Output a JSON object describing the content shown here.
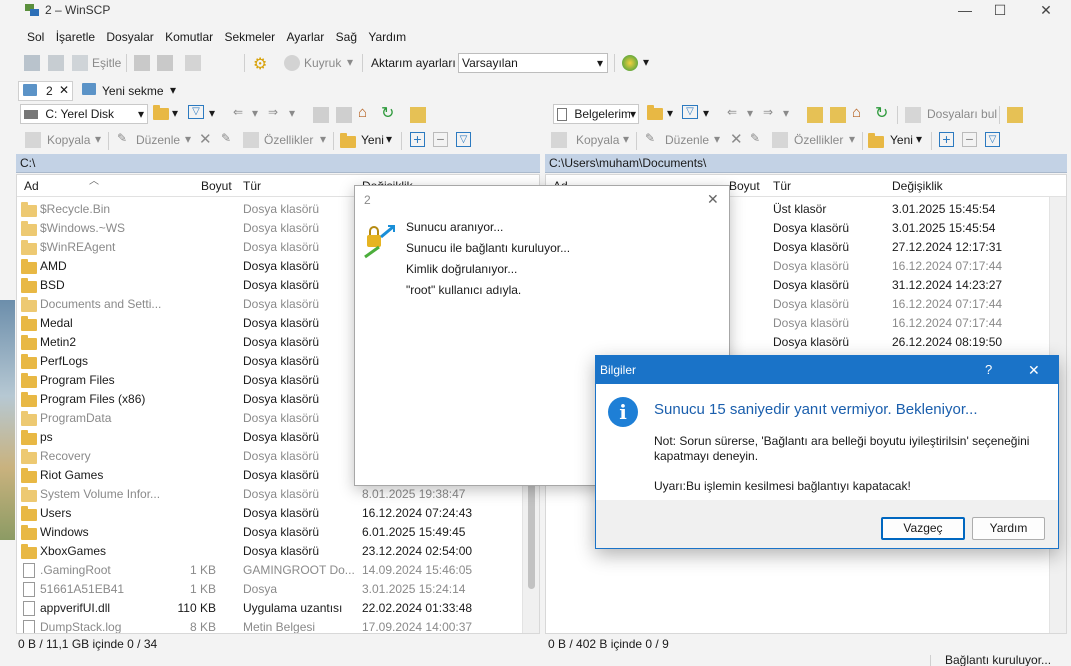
{
  "window": {
    "title": "2 – WinSCP",
    "minimize_glyph": "—",
    "maximize_glyph": "☐",
    "close_glyph": "✕"
  },
  "menu": [
    "Sol",
    "İşaretle",
    "Dosyalar",
    "Komutlar",
    "Sekmeler",
    "Ayarlar",
    "Sağ",
    "Yardım"
  ],
  "toolbar1": {
    "sync_label": "Eşitle",
    "queue_label": "Kuyruk",
    "transfer_settings_label": "Aktarım ayarları",
    "transfer_settings_value": "Varsayılan"
  },
  "tabs": {
    "session_tab": "2",
    "new_tab": "Yeni sekme"
  },
  "left": {
    "drive": "C: Yerel Disk",
    "copy": "Kopyala",
    "edit": "Düzenle",
    "properties": "Özellikler",
    "new": "Yeni",
    "path": "C:\\",
    "columns": {
      "name": "Ad",
      "size": "Boyut",
      "type": "Tür",
      "changed": "Değişiklik"
    },
    "rows": [
      {
        "name": "$Recycle.Bin",
        "size": "",
        "type": "Dosya klasörü",
        "changed": "",
        "hidden": true,
        "icon": "folder"
      },
      {
        "name": "$Windows.~WS",
        "size": "",
        "type": "Dosya klasörü",
        "changed": "",
        "hidden": true,
        "icon": "folder"
      },
      {
        "name": "$WinREAgent",
        "size": "",
        "type": "Dosya klasörü",
        "changed": "",
        "hidden": true,
        "icon": "folder"
      },
      {
        "name": "AMD",
        "size": "",
        "type": "Dosya klasörü",
        "changed": "",
        "hidden": false,
        "icon": "folder"
      },
      {
        "name": "BSD",
        "size": "",
        "type": "Dosya klasörü",
        "changed": "",
        "hidden": false,
        "icon": "folder"
      },
      {
        "name": "Documents and Setti...",
        "size": "",
        "type": "Dosya klasörü",
        "changed": "",
        "hidden": true,
        "icon": "folder"
      },
      {
        "name": "Medal",
        "size": "",
        "type": "Dosya klasörü",
        "changed": "",
        "hidden": false,
        "icon": "folder"
      },
      {
        "name": "Metin2",
        "size": "",
        "type": "Dosya klasörü",
        "changed": "",
        "hidden": false,
        "icon": "folder"
      },
      {
        "name": "PerfLogs",
        "size": "",
        "type": "Dosya klasörü",
        "changed": "",
        "hidden": false,
        "icon": "folder"
      },
      {
        "name": "Program Files",
        "size": "",
        "type": "Dosya klasörü",
        "changed": "",
        "hidden": false,
        "icon": "folder"
      },
      {
        "name": "Program Files (x86)",
        "size": "",
        "type": "Dosya klasörü",
        "changed": "",
        "hidden": false,
        "icon": "folder"
      },
      {
        "name": "ProgramData",
        "size": "",
        "type": "Dosya klasörü",
        "changed": "",
        "hidden": true,
        "icon": "folder"
      },
      {
        "name": "ps",
        "size": "",
        "type": "Dosya klasörü",
        "changed": "",
        "hidden": false,
        "icon": "folder"
      },
      {
        "name": "Recovery",
        "size": "",
        "type": "Dosya klasörü",
        "changed": "",
        "hidden": true,
        "icon": "folder"
      },
      {
        "name": "Riot Games",
        "size": "",
        "type": "Dosya klasörü",
        "changed": "",
        "hidden": false,
        "icon": "folder"
      },
      {
        "name": "System Volume Infor...",
        "size": "",
        "type": "Dosya klasörü",
        "changed": "8.01.2025 19:38:47",
        "hidden": true,
        "icon": "folder"
      },
      {
        "name": "Users",
        "size": "",
        "type": "Dosya klasörü",
        "changed": "16.12.2024 07:24:43",
        "hidden": false,
        "icon": "folder"
      },
      {
        "name": "Windows",
        "size": "",
        "type": "Dosya klasörü",
        "changed": "6.01.2025 15:49:45",
        "hidden": false,
        "icon": "folder"
      },
      {
        "name": "XboxGames",
        "size": "",
        "type": "Dosya klasörü",
        "changed": "23.12.2024 02:54:00",
        "hidden": false,
        "icon": "folder"
      },
      {
        "name": ".GamingRoot",
        "size": "1 KB",
        "type": "GAMINGROOT Do...",
        "changed": "14.09.2024 15:46:05",
        "hidden": true,
        "icon": "file"
      },
      {
        "name": "51661A51EB41",
        "size": "1 KB",
        "type": "Dosya",
        "changed": "3.01.2025 15:24:14",
        "hidden": true,
        "icon": "file"
      },
      {
        "name": "appverifUI.dll",
        "size": "110 KB",
        "type": "Uygulama uzantısı",
        "changed": "22.02.2024 01:33:48",
        "hidden": false,
        "icon": "file"
      },
      {
        "name": "DumpStack.log",
        "size": "8 KB",
        "type": "Metin Belgesi",
        "changed": "17.09.2024 14:00:37",
        "hidden": true,
        "icon": "file"
      }
    ],
    "status": "0 B / 11,1 GB içinde 0 / 34"
  },
  "right": {
    "folder": "Belgelerim",
    "find_files": "Dosyaları bul",
    "copy": "Kopyala",
    "edit": "Düzenle",
    "properties": "Özellikler",
    "new": "Yeni",
    "path": "C:\\Users\\muham\\Documents\\",
    "columns": {
      "name": "Ad",
      "size": "Boyut",
      "type": "Tür",
      "changed": "Değişiklik"
    },
    "rows": [
      {
        "type": "Üst klasör",
        "changed": "3.01.2025 15:45:54",
        "hidden": false
      },
      {
        "type": "Dosya klasörü",
        "changed": "3.01.2025 15:45:54",
        "hidden": false
      },
      {
        "type": "Dosya klasörü",
        "changed": "27.12.2024 12:17:31",
        "hidden": false
      },
      {
        "type": "Dosya klasörü",
        "changed": "16.12.2024 07:17:44",
        "hidden": true
      },
      {
        "type": "Dosya klasörü",
        "changed": "31.12.2024 14:23:27",
        "hidden": false
      },
      {
        "type": "Dosya klasörü",
        "changed": "16.12.2024 07:17:44",
        "hidden": true
      },
      {
        "type": "Dosya klasörü",
        "changed": "16.12.2024 07:17:44",
        "hidden": true
      },
      {
        "type": "Dosya klasörü",
        "changed": "26.12.2024 08:19:50",
        "hidden": false
      }
    ],
    "status": "0 B / 402 B içinde 0 / 9"
  },
  "connecting_dialog": {
    "title": "2",
    "lines": [
      "Sunucu aranıyor...",
      "Sunucu ile bağlantı kuruluyor...",
      "Kimlik doğrulanıyor...",
      "\"root\" kullanıcı adıyla."
    ]
  },
  "info_dialog": {
    "title": "Bilgiler",
    "help_glyph": "?",
    "close_glyph": "✕",
    "heading": "Sunucu 15 saniyedir yanıt vermiyor. Bekleniyor...",
    "note_line1": "Not: Sorun sürerse, 'Bağlantı ara belleği boyutu iyileştirilsin' seçeneğini",
    "note_line2": "kapatmayı deneyin.",
    "warning": "Uyarı:Bu işlemin kesilmesi bağlantıyı kapatacak!",
    "cancel_label": "Vazgeç",
    "help_label": "Yardım"
  },
  "bottom_status": "Bağlantı kuruluyor...",
  "colors": {
    "accent": "#1a73c8",
    "pathbar": "#c3d2e5",
    "folder": "#e8b844"
  }
}
